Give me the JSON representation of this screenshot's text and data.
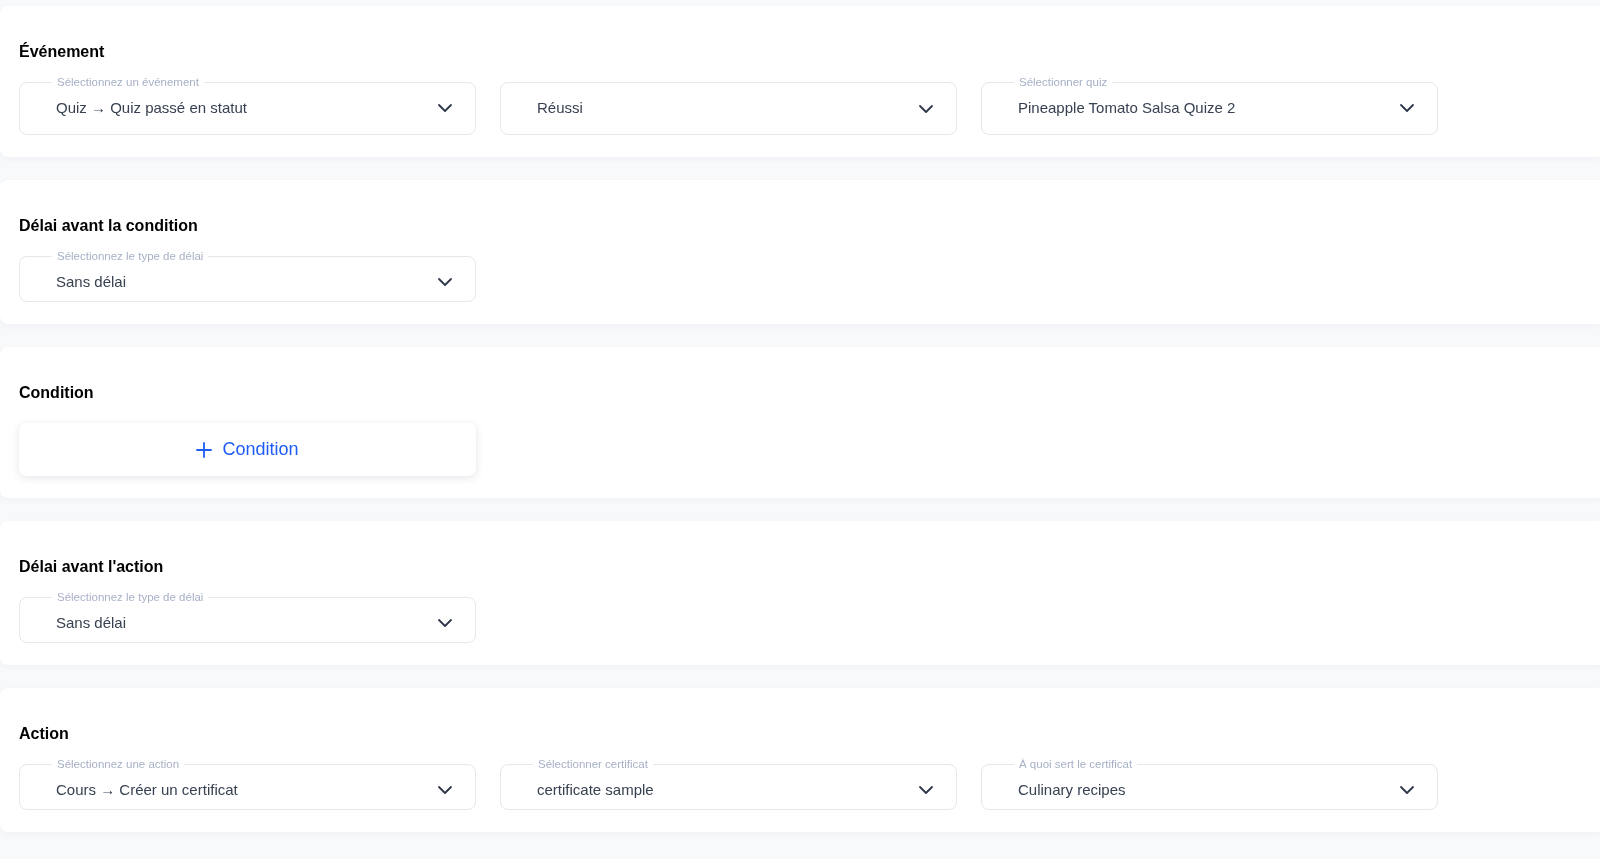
{
  "sections": [
    {
      "title": "Événement",
      "kind": "selects",
      "selects": [
        {
          "label": "Sélectionnez un événement",
          "value": "Quiz → Quiz passé en statut"
        },
        {
          "value": "Réussi"
        },
        {
          "label": "Sélectionner quiz",
          "value": "Pineapple Tomato Salsa Quize 2"
        }
      ]
    },
    {
      "title": "Délai avant la condition",
      "kind": "selects",
      "selects": [
        {
          "label": "Sélectionnez le type de délai",
          "value": "Sans délai"
        }
      ]
    },
    {
      "title": "Condition",
      "kind": "button",
      "button": {
        "label": "Condition"
      }
    },
    {
      "title": "Délai avant l'action",
      "kind": "selects",
      "selects": [
        {
          "label": "Sélectionnez le type de délai",
          "value": "Sans délai"
        }
      ]
    },
    {
      "title": "Action",
      "kind": "selects",
      "selects": [
        {
          "label": "Sélectionnez une action",
          "value": "Cours → Créer un certificat"
        },
        {
          "label": "Sélectionner certificat",
          "value": "certificate sample"
        },
        {
          "label": "À quoi sert le certificat",
          "value": "Culinary recipes"
        }
      ]
    }
  ]
}
